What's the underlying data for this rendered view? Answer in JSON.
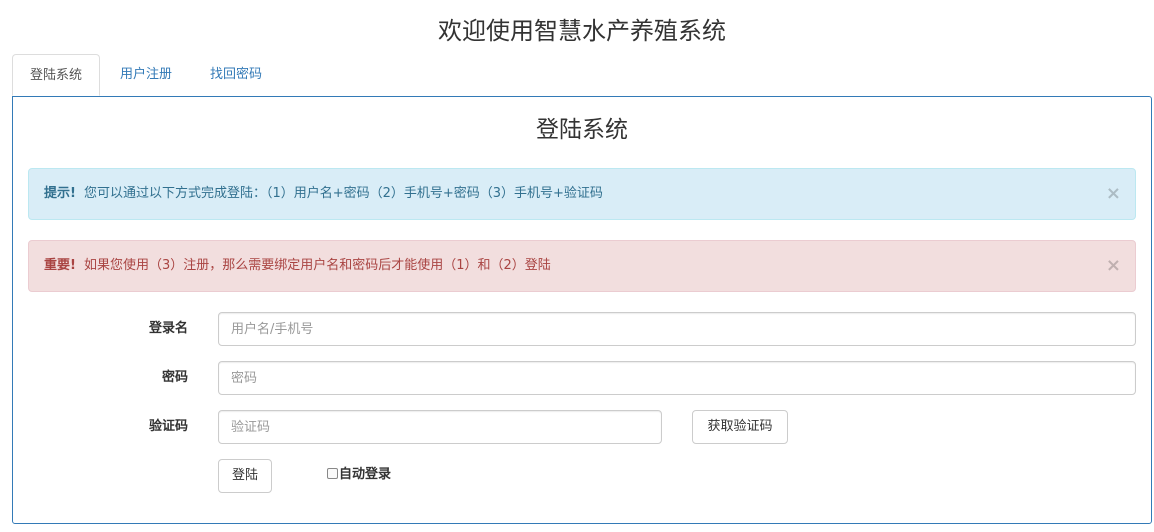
{
  "page": {
    "title": "欢迎使用智慧水产养殖系统"
  },
  "tabs": [
    {
      "label": "登陆系统",
      "active": true
    },
    {
      "label": "用户注册",
      "active": false
    },
    {
      "label": "找回密码",
      "active": false
    }
  ],
  "panel": {
    "title": "登陆系统"
  },
  "alerts": {
    "info": {
      "strong": "提示!",
      "text": "您可以通过以下方式完成登陆：（1）用户名+密码（2）手机号+密码（3）手机号+验证码",
      "close": "×"
    },
    "danger": {
      "strong": "重要!",
      "text": "如果您使用（3）注册，那么需要绑定用户名和密码后才能使用（1）和（2）登陆",
      "close": "×"
    }
  },
  "form": {
    "username": {
      "label": "登录名",
      "placeholder": "用户名/手机号",
      "value": ""
    },
    "password": {
      "label": "密码",
      "placeholder": "密码",
      "value": ""
    },
    "captcha": {
      "label": "验证码",
      "placeholder": "验证码",
      "value": "",
      "button": "获取验证码"
    },
    "submit_label": "登陆",
    "remember": {
      "label": "自动登录",
      "checked": false
    }
  },
  "colors": {
    "link": "#337ab7",
    "panel_border": "#337ab7",
    "info_bg": "#d9edf7",
    "info_text": "#31708f",
    "danger_bg": "#f2dede",
    "danger_text": "#a94442"
  }
}
